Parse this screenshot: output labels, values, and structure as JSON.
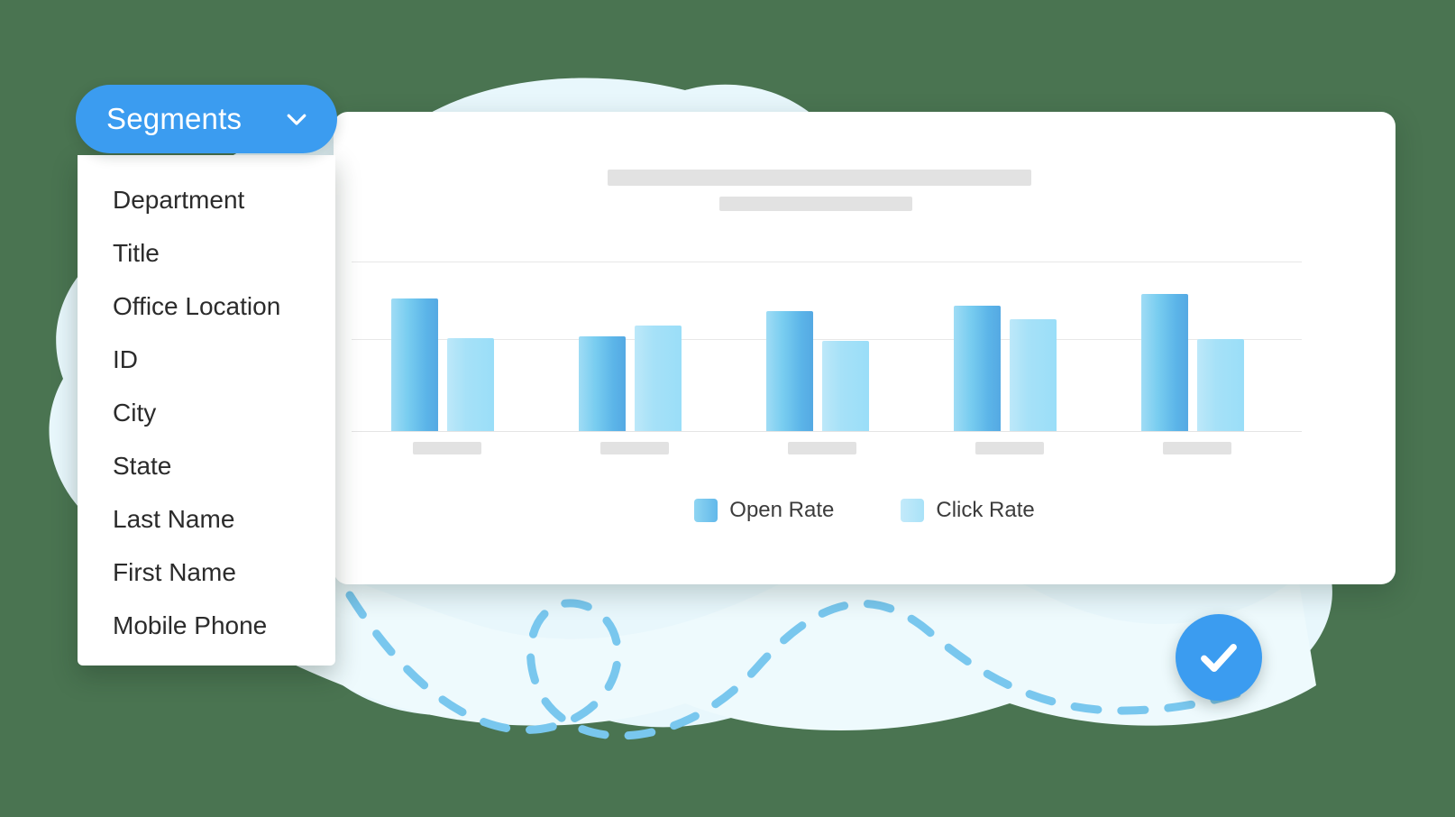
{
  "background_color": "#4a7451",
  "accent_color": "#3b9cf0",
  "segments": {
    "button_label": "Segments",
    "chevron_icon": "chevron-down-icon",
    "items": [
      {
        "label": "Department"
      },
      {
        "label": "Title"
      },
      {
        "label": "Office Location"
      },
      {
        "label": "ID"
      },
      {
        "label": "City"
      },
      {
        "label": "State"
      },
      {
        "label": "Last Name"
      },
      {
        "label": "First Name"
      },
      {
        "label": "Mobile Phone"
      }
    ]
  },
  "card": {
    "title_placeholder": "",
    "subtitle_placeholder": ""
  },
  "badge": {
    "icon": "check-icon"
  },
  "chart_data": {
    "type": "bar",
    "title": "",
    "subtitle": "",
    "xlabel": "",
    "ylabel": "",
    "categories": [
      "",
      "",
      "",
      "",
      ""
    ],
    "category_labels_hidden": true,
    "ylim": [
      0,
      100
    ],
    "grid": true,
    "gridlines": [
      100,
      54,
      0
    ],
    "legend_position": "bottom-center",
    "series": [
      {
        "name": "Open Rate",
        "color": "#62b8ea",
        "values": [
          78,
          56,
          71,
          74,
          81
        ]
      },
      {
        "name": "Click Rate",
        "color": "#a9e2f8",
        "values": [
          55,
          62,
          53,
          66,
          54
        ]
      }
    ]
  }
}
